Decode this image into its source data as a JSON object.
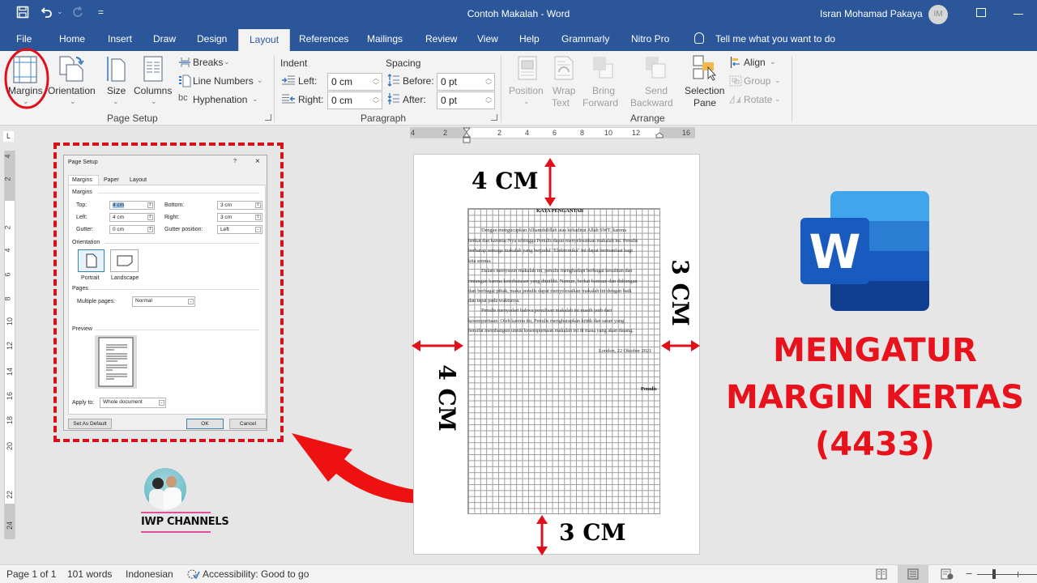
{
  "titlebar": {
    "document_title": "Contoh Makalah  -  Word",
    "user_name": "Isran Mohamad Pakaya",
    "user_initials": "IM",
    "qat_more": "="
  },
  "tabs": [
    {
      "label": "File"
    },
    {
      "label": "Home"
    },
    {
      "label": "Insert"
    },
    {
      "label": "Draw"
    },
    {
      "label": "Design"
    },
    {
      "label": "Layout",
      "active": true
    },
    {
      "label": "References"
    },
    {
      "label": "Mailings"
    },
    {
      "label": "Review"
    },
    {
      "label": "View"
    },
    {
      "label": "Help"
    },
    {
      "label": "Grammarly"
    },
    {
      "label": "Nitro Pro"
    }
  ],
  "tell_me": "Tell me what you want to do",
  "ribbon": {
    "page_setup": {
      "group_label": "Page Setup",
      "margins": "Margins",
      "orientation": "Orientation",
      "size": "Size",
      "columns": "Columns",
      "breaks": "Breaks",
      "line_numbers": "Line Numbers",
      "hyphenation": "Hyphenation"
    },
    "paragraph": {
      "group_label": "Paragraph",
      "indent_heading": "Indent",
      "spacing_heading": "Spacing",
      "left_label": "Left:",
      "left_value": "0 cm",
      "right_label": "Right:",
      "right_value": "0 cm",
      "before_label": "Before:",
      "before_value": "0 pt",
      "after_label": "After:",
      "after_value": "0 pt"
    },
    "arrange": {
      "group_label": "Arrange",
      "position": "Position",
      "wrap_text_1": "Wrap",
      "wrap_text_2": "Text",
      "bring_forward_1": "Bring",
      "bring_forward_2": "Forward",
      "send_backward_1": "Send",
      "send_backward_2": "Backward",
      "selection_pane_1": "Selection",
      "selection_pane_2": "Pane",
      "align": "Align",
      "group": "Group",
      "rotate": "Rotate"
    }
  },
  "ruler": {
    "horizontal_ticks": [
      "4",
      "2",
      "2",
      "4",
      "6",
      "8",
      "10",
      "12",
      "16"
    ],
    "vertical_ticks": [
      "4",
      "2",
      "2",
      "4",
      "6",
      "8",
      "10",
      "12",
      "14",
      "16",
      "18",
      "20",
      "22",
      "24"
    ]
  },
  "dialog": {
    "title": "Page Setup",
    "help": "?",
    "close": "×",
    "tabs": [
      "Margins",
      "Paper",
      "Layout"
    ],
    "active_tab": "Margins",
    "margins_section": "Margins",
    "top_label": "Top:",
    "top_value": "4 cm",
    "bottom_label": "Bottom:",
    "bottom_value": "3 cm",
    "left_label": "Left:",
    "left_value": "4 cm",
    "right_label": "Right:",
    "right_value": "3 cm",
    "gutter_label": "Gutter:",
    "gutter_value": "0 cm",
    "gutter_position_label": "Gutter position:",
    "gutter_position_value": "Left",
    "orientation_section": "Orientation",
    "portrait": "Portrait",
    "landscape": "Landscape",
    "pages_section": "Pages",
    "multiple_pages_label": "Multiple pages:",
    "multiple_pages_value": "Normal",
    "preview_section": "Preview",
    "apply_to_label": "Apply to:",
    "apply_to_value": "Whole document",
    "set_default": "Set As Default",
    "ok": "OK",
    "cancel": "Cancel"
  },
  "document": {
    "heading": "KATA PENGANTAR",
    "lines": [
      "Dengan mengucapkan Alhamdulillah atas kehadirat Allah SWT, karena",
      "berkat dan karunia-Nya sehingga Penulis dapat menyelesaikan makalah ini. Penulis",
      "berharap semoga makalah yang berjudul \"Elektronika\" ini dapat bermanfaat bagi",
      "kita semua.",
      "Dalam menyusun makalah ini, penulis menghadapi berbagai kesulitan dan",
      "rintangan karena keterbatasan yang dimiliki. Namun, berkat bantuan dan dukungan",
      "dari berbagai pihak, maka penulis dapat menyelesaikan makalah ini dengan baik",
      "dan tepat pada waktunya.",
      "Penulis menyadari bahwa penulisan makalah ini masih jauh dari",
      "kesempurnaan. Oleh karena itu, Penulis mengharapkan kritik dan saran yang",
      "bersifat membangun untuk kesempurnaan makalah ini di masa yang akan datang."
    ],
    "place_date": "London, 22 Oktober 2021",
    "signature": "Penulis"
  },
  "annotations": {
    "top": "4 CM",
    "left": "4 CM",
    "right": "3 CM",
    "bottom": "3 CM",
    "accent_color": "#e8121c"
  },
  "channel": {
    "name": "IWP CHANNELS"
  },
  "headline": {
    "line1": "MENGATUR",
    "line2": "MARGIN KERTAS",
    "line3": "(4433)"
  },
  "word_logo_letter": "W",
  "statusbar": {
    "page": "Page 1 of 1",
    "words": "101 words",
    "language": "Indonesian",
    "accessibility": "Accessibility: Good to go"
  },
  "colors": {
    "word_blue": "#2b579a",
    "ribbon_bg": "#f3f3f3",
    "highlight_red": "#d4121a"
  }
}
